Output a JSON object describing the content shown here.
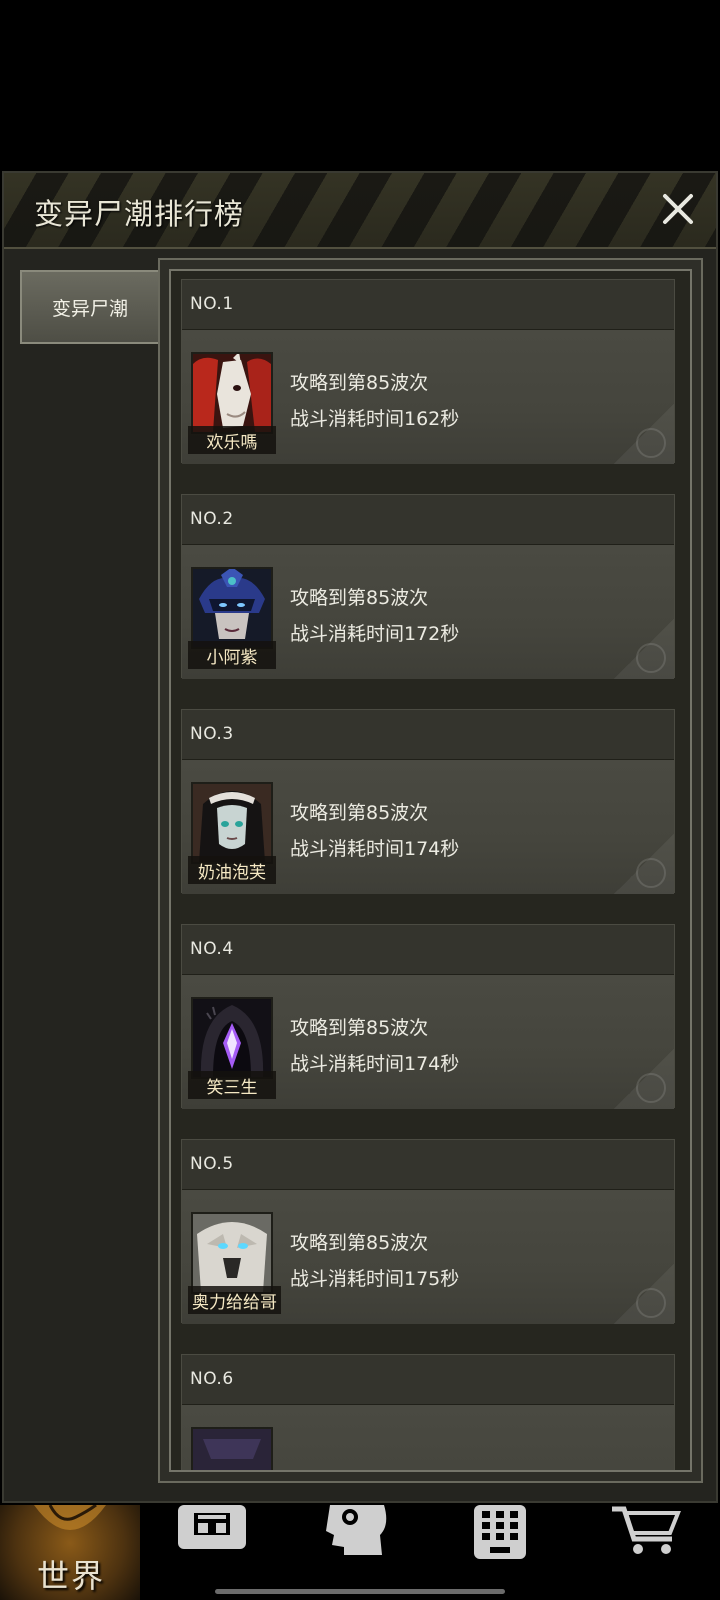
{
  "modal": {
    "title": "变异尸潮排行榜"
  },
  "tabs": [
    {
      "label": "变异尸潮",
      "active": true
    }
  ],
  "rankings": [
    {
      "rank": "NO.1",
      "name": "欢乐嗎",
      "progress": "攻略到第85波次",
      "time": "战斗消耗时间162秒",
      "avatar": "red-haired-horse-portrait"
    },
    {
      "rank": "NO.2",
      "name": "小阿紫",
      "progress": "攻略到第85波次",
      "time": "战斗消耗时间172秒",
      "avatar": "blue-masked-woman-portrait"
    },
    {
      "rank": "NO.3",
      "name": "奶油泡芙",
      "progress": "攻略到第85波次",
      "time": "战斗消耗时间174秒",
      "avatar": "dark-haired-maid-portrait"
    },
    {
      "rank": "NO.4",
      "name": "笑三生",
      "progress": "攻略到第85波次",
      "time": "战斗消耗时间174秒",
      "avatar": "purple-crystal-hooded-portrait"
    },
    {
      "rank": "NO.5",
      "name": "奥力给给哥",
      "progress": "攻略到第85波次",
      "time": "战斗消耗时间175秒",
      "avatar": "white-wolf-portrait"
    },
    {
      "rank": "NO.6",
      "name": "",
      "progress": "",
      "time": "",
      "avatar": "partial-portrait"
    }
  ],
  "bottom_nav": {
    "items": [
      {
        "label": "世界",
        "icon": "globe-icon",
        "active": true
      },
      {
        "label": "",
        "icon": "backpack-icon"
      },
      {
        "label": "",
        "icon": "head-gear-icon"
      },
      {
        "label": "",
        "icon": "phone-keypad-icon"
      },
      {
        "label": "",
        "icon": "shopping-cart-icon"
      }
    ]
  },
  "colors": {
    "accent_gold": "#f6e9c4",
    "panel": "#45453d",
    "nav_active": "#8a5a18"
  }
}
